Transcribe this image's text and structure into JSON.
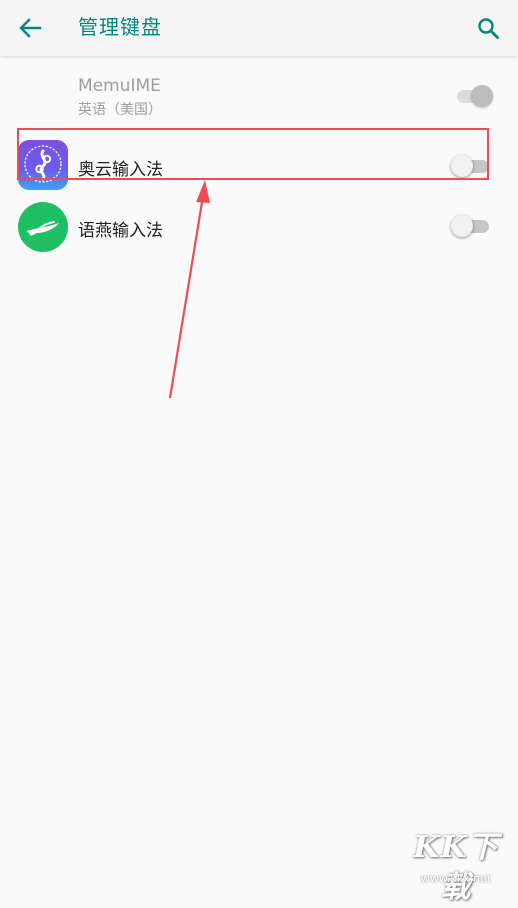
{
  "header": {
    "title": "管理键盘",
    "back_icon": "back-arrow-icon",
    "search_icon": "search-icon",
    "accent_color": "#00897b"
  },
  "keyboards": [
    {
      "name": "MemuIME",
      "subtitle": "英语（美国）",
      "enabled": true,
      "locked": true
    },
    {
      "name": "奥云输入法",
      "icon": "aoyun-app-icon",
      "enabled": false,
      "highlighted": true
    },
    {
      "name": "语燕输入法",
      "icon": "yuyan-app-icon",
      "enabled": false
    }
  ],
  "annotation": {
    "highlight_color": "#ee4b57"
  },
  "watermark": {
    "title": "KK下载",
    "url": "www.kkx.net"
  }
}
